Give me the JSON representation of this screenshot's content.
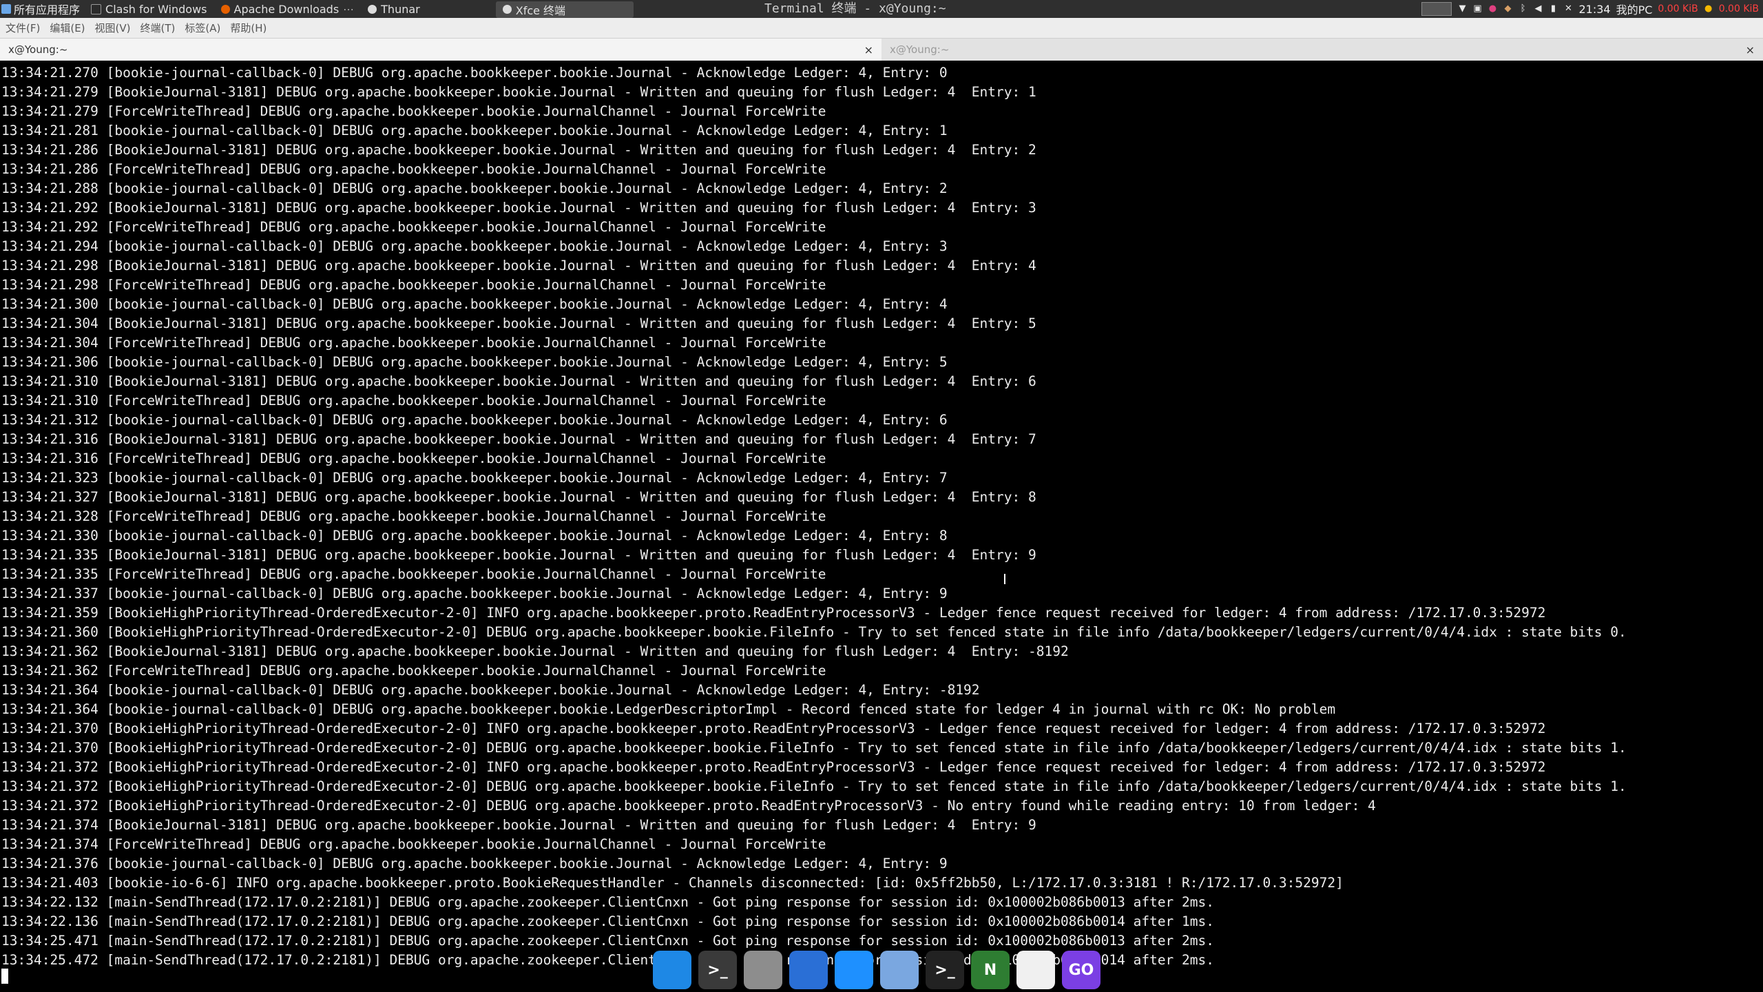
{
  "panel": {
    "apps_menu_label": "所有应用程序",
    "tasks": [
      {
        "label": "Clash for Windows",
        "icon": "clash-icon",
        "color": "#2b2b2b"
      },
      {
        "label": "Apache Downloads",
        "icon": "firefox-icon",
        "color": "#e66000"
      },
      {
        "label": "Thunar",
        "icon": "thunar-icon",
        "color": "#ddd"
      },
      {
        "label": "Xfce 终端",
        "icon": "terminal-icon",
        "color": "#ddd"
      }
    ],
    "window_title": "Terminal 终端 - x@Young:~",
    "net_speed": "0.00 KiB",
    "net_speed_2": "0.00 KiB",
    "clock": "21:34",
    "user_label": "我的PC"
  },
  "menubar": {
    "items": [
      "文件(F)",
      "编辑(E)",
      "视图(V)",
      "终端(T)",
      "标签(A)",
      "帮助(H)"
    ]
  },
  "tabs": [
    {
      "label": "x@Young:~",
      "close": "×"
    },
    {
      "label": "x@Young:~",
      "close": "×"
    }
  ],
  "terminal": {
    "lines": [
      "13:34:21.270 [bookie-journal-callback-0] DEBUG org.apache.bookkeeper.bookie.Journal - Acknowledge Ledger: 4, Entry: 0",
      "13:34:21.279 [BookieJournal-3181] DEBUG org.apache.bookkeeper.bookie.Journal - Written and queuing for flush Ledger: 4  Entry: 1",
      "13:34:21.279 [ForceWriteThread] DEBUG org.apache.bookkeeper.bookie.JournalChannel - Journal ForceWrite",
      "13:34:21.281 [bookie-journal-callback-0] DEBUG org.apache.bookkeeper.bookie.Journal - Acknowledge Ledger: 4, Entry: 1",
      "13:34:21.286 [BookieJournal-3181] DEBUG org.apache.bookkeeper.bookie.Journal - Written and queuing for flush Ledger: 4  Entry: 2",
      "13:34:21.286 [ForceWriteThread] DEBUG org.apache.bookkeeper.bookie.JournalChannel - Journal ForceWrite",
      "13:34:21.288 [bookie-journal-callback-0] DEBUG org.apache.bookkeeper.bookie.Journal - Acknowledge Ledger: 4, Entry: 2",
      "13:34:21.292 [BookieJournal-3181] DEBUG org.apache.bookkeeper.bookie.Journal - Written and queuing for flush Ledger: 4  Entry: 3",
      "13:34:21.292 [ForceWriteThread] DEBUG org.apache.bookkeeper.bookie.JournalChannel - Journal ForceWrite",
      "13:34:21.294 [bookie-journal-callback-0] DEBUG org.apache.bookkeeper.bookie.Journal - Acknowledge Ledger: 4, Entry: 3",
      "13:34:21.298 [BookieJournal-3181] DEBUG org.apache.bookkeeper.bookie.Journal - Written and queuing for flush Ledger: 4  Entry: 4",
      "13:34:21.298 [ForceWriteThread] DEBUG org.apache.bookkeeper.bookie.JournalChannel - Journal ForceWrite",
      "13:34:21.300 [bookie-journal-callback-0] DEBUG org.apache.bookkeeper.bookie.Journal - Acknowledge Ledger: 4, Entry: 4",
      "13:34:21.304 [BookieJournal-3181] DEBUG org.apache.bookkeeper.bookie.Journal - Written and queuing for flush Ledger: 4  Entry: 5",
      "13:34:21.304 [ForceWriteThread] DEBUG org.apache.bookkeeper.bookie.JournalChannel - Journal ForceWrite",
      "13:34:21.306 [bookie-journal-callback-0] DEBUG org.apache.bookkeeper.bookie.Journal - Acknowledge Ledger: 4, Entry: 5",
      "13:34:21.310 [BookieJournal-3181] DEBUG org.apache.bookkeeper.bookie.Journal - Written and queuing for flush Ledger: 4  Entry: 6",
      "13:34:21.310 [ForceWriteThread] DEBUG org.apache.bookkeeper.bookie.JournalChannel - Journal ForceWrite",
      "13:34:21.312 [bookie-journal-callback-0] DEBUG org.apache.bookkeeper.bookie.Journal - Acknowledge Ledger: 4, Entry: 6",
      "13:34:21.316 [BookieJournal-3181] DEBUG org.apache.bookkeeper.bookie.Journal - Written and queuing for flush Ledger: 4  Entry: 7",
      "13:34:21.316 [ForceWriteThread] DEBUG org.apache.bookkeeper.bookie.JournalChannel - Journal ForceWrite",
      "13:34:21.323 [bookie-journal-callback-0] DEBUG org.apache.bookkeeper.bookie.Journal - Acknowledge Ledger: 4, Entry: 7",
      "13:34:21.327 [BookieJournal-3181] DEBUG org.apache.bookkeeper.bookie.Journal - Written and queuing for flush Ledger: 4  Entry: 8",
      "13:34:21.328 [ForceWriteThread] DEBUG org.apache.bookkeeper.bookie.JournalChannel - Journal ForceWrite",
      "13:34:21.330 [bookie-journal-callback-0] DEBUG org.apache.bookkeeper.bookie.Journal - Acknowledge Ledger: 4, Entry: 8",
      "13:34:21.335 [BookieJournal-3181] DEBUG org.apache.bookkeeper.bookie.Journal - Written and queuing for flush Ledger: 4  Entry: 9",
      "13:34:21.335 [ForceWriteThread] DEBUG org.apache.bookkeeper.bookie.JournalChannel - Journal ForceWrite",
      "13:34:21.337 [bookie-journal-callback-0] DEBUG org.apache.bookkeeper.bookie.Journal - Acknowledge Ledger: 4, Entry: 9",
      "13:34:21.359 [BookieHighPriorityThread-OrderedExecutor-2-0] INFO org.apache.bookkeeper.proto.ReadEntryProcessorV3 - Ledger fence request received for ledger: 4 from address: /172.17.0.3:52972",
      "13:34:21.360 [BookieHighPriorityThread-OrderedExecutor-2-0] DEBUG org.apache.bookkeeper.bookie.FileInfo - Try to set fenced state in file info /data/bookkeeper/ledgers/current/0/4/4.idx : state bits 0.",
      "13:34:21.362 [BookieJournal-3181] DEBUG org.apache.bookkeeper.bookie.Journal - Written and queuing for flush Ledger: 4  Entry: -8192",
      "13:34:21.362 [ForceWriteThread] DEBUG org.apache.bookkeeper.bookie.JournalChannel - Journal ForceWrite",
      "13:34:21.364 [bookie-journal-callback-0] DEBUG org.apache.bookkeeper.bookie.Journal - Acknowledge Ledger: 4, Entry: -8192",
      "13:34:21.364 [bookie-journal-callback-0] DEBUG org.apache.bookkeeper.bookie.LedgerDescriptorImpl - Record fenced state for ledger 4 in journal with rc OK: No problem",
      "13:34:21.370 [BookieHighPriorityThread-OrderedExecutor-2-0] INFO org.apache.bookkeeper.proto.ReadEntryProcessorV3 - Ledger fence request received for ledger: 4 from address: /172.17.0.3:52972",
      "13:34:21.370 [BookieHighPriorityThread-OrderedExecutor-2-0] DEBUG org.apache.bookkeeper.bookie.FileInfo - Try to set fenced state in file info /data/bookkeeper/ledgers/current/0/4/4.idx : state bits 1.",
      "13:34:21.372 [BookieHighPriorityThread-OrderedExecutor-2-0] INFO org.apache.bookkeeper.proto.ReadEntryProcessorV3 - Ledger fence request received for ledger: 4 from address: /172.17.0.3:52972",
      "13:34:21.372 [BookieHighPriorityThread-OrderedExecutor-2-0] DEBUG org.apache.bookkeeper.bookie.FileInfo - Try to set fenced state in file info /data/bookkeeper/ledgers/current/0/4/4.idx : state bits 1.",
      "13:34:21.372 [BookieHighPriorityThread-OrderedExecutor-2-0] DEBUG org.apache.bookkeeper.proto.ReadEntryProcessorV3 - No entry found while reading entry: 10 from ledger: 4",
      "13:34:21.374 [BookieJournal-3181] DEBUG org.apache.bookkeeper.bookie.Journal - Written and queuing for flush Ledger: 4  Entry: 9",
      "13:34:21.374 [ForceWriteThread] DEBUG org.apache.bookkeeper.bookie.JournalChannel - Journal ForceWrite",
      "13:34:21.376 [bookie-journal-callback-0] DEBUG org.apache.bookkeeper.bookie.Journal - Acknowledge Ledger: 4, Entry: 9",
      "13:34:21.403 [bookie-io-6-6] INFO org.apache.bookkeeper.proto.BookieRequestHandler - Channels disconnected: [id: 0x5ff2bb50, L:/172.17.0.3:3181 ! R:/172.17.0.3:52972]",
      "13:34:22.132 [main-SendThread(172.17.0.2:2181)] DEBUG org.apache.zookeeper.ClientCnxn - Got ping response for session id: 0x100002b086b0013 after 2ms.",
      "13:34:22.136 [main-SendThread(172.17.0.2:2181)] DEBUG org.apache.zookeeper.ClientCnxn - Got ping response for session id: 0x100002b086b0014 after 1ms.",
      "13:34:25.471 [main-SendThread(172.17.0.2:2181)] DEBUG org.apache.zookeeper.ClientCnxn - Got ping response for session id: 0x100002b086b0013 after 2ms.",
      "13:34:25.472 [main-SendThread(172.17.0.2:2181)] DEBUG org.apache.zookeeper.ClientCnxn - Got ping response for session id: 0x100002b086b0014 after 2ms."
    ]
  },
  "dock": [
    {
      "name": "files-app-icon",
      "color": "#1e88e5",
      "glyph": ""
    },
    {
      "name": "terminal-app-icon",
      "color": "#3a3a3a",
      "glyph": ">_"
    },
    {
      "name": "archive-app-icon",
      "color": "#8d8d8d",
      "glyph": ""
    },
    {
      "name": "browser-app-icon",
      "color": "#2a6fd6",
      "glyph": ""
    },
    {
      "name": "search-app-icon",
      "color": "#1e90ff",
      "glyph": ""
    },
    {
      "name": "folder-app-icon",
      "color": "#7aa7e0",
      "glyph": ""
    },
    {
      "name": "console-app-icon",
      "color": "#222",
      "glyph": ">_"
    },
    {
      "name": "neovim-app-icon",
      "color": "#2e7d32",
      "glyph": "N"
    },
    {
      "name": "cat-app-icon",
      "color": "#f0f0f0",
      "glyph": ""
    },
    {
      "name": "goland-app-icon",
      "color": "#7b3fe4",
      "glyph": "GO"
    }
  ]
}
